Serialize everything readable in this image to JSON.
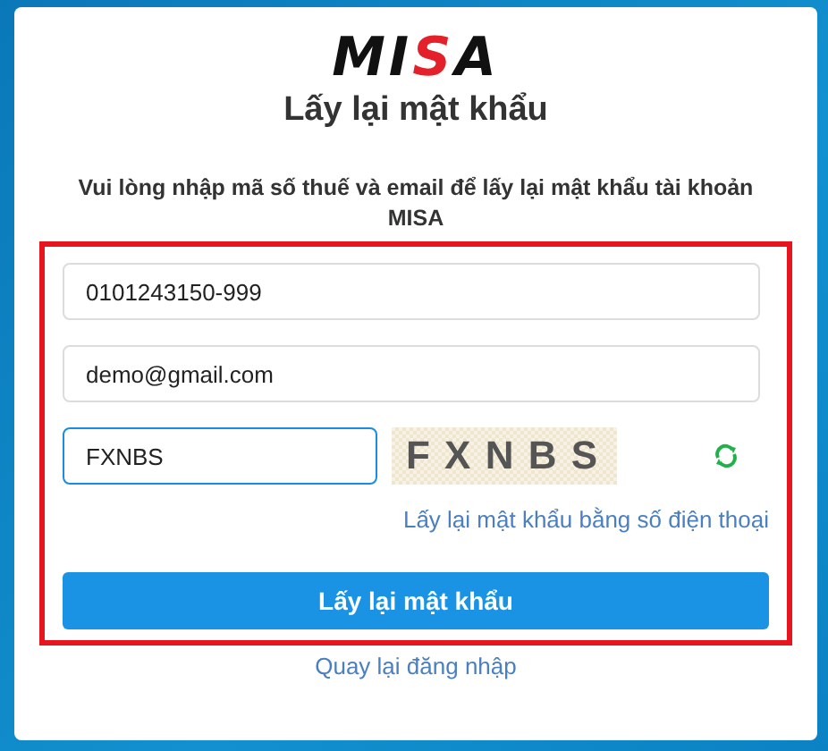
{
  "logo": {
    "letters": [
      {
        "char": "M",
        "accent": false
      },
      {
        "char": "I",
        "accent": false
      },
      {
        "char": "S",
        "accent": true
      },
      {
        "char": "A",
        "accent": false
      }
    ]
  },
  "title": "Lấy lại mật khẩu",
  "instruction": "Vui lòng nhập mã số thuế và email để lấy lại mật khẩu tài khoản MISA",
  "form": {
    "highlighted": true,
    "fields": [
      {
        "value": "0101243150-999",
        "focused": false
      },
      {
        "value": "demo@gmail.com",
        "focused": false
      }
    ],
    "captcha": {
      "value": "FXNBS",
      "focused": true,
      "image_text": "F X N B S"
    },
    "phone_link": "Lấy lại mật khẩu bằng số điện thoại",
    "submit_button": "Lấy lại mật khẩu"
  },
  "back_link": "Quay lại đăng nhập"
}
